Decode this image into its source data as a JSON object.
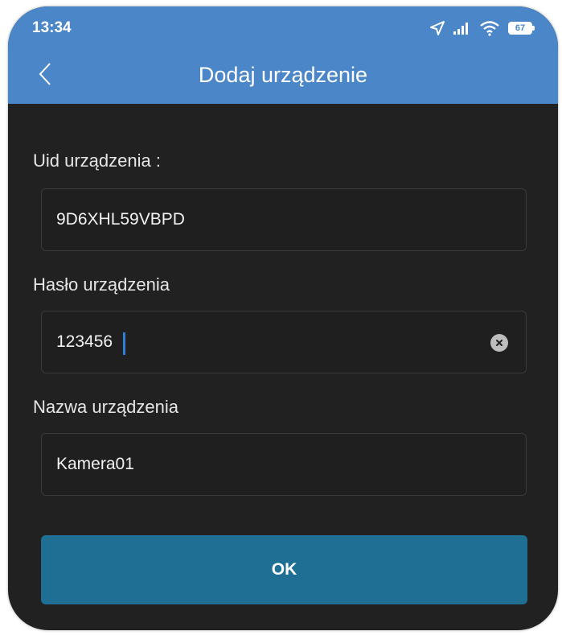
{
  "status_bar": {
    "time": "13:34",
    "battery": "67"
  },
  "header": {
    "title": "Dodaj urządzenie",
    "back_icon": "chevron-left-icon"
  },
  "form": {
    "uid": {
      "label": "Uid urządzenia :",
      "value": "9D6XHL59VBPD"
    },
    "password": {
      "label": "Hasło urządzenia",
      "value": "123456",
      "clear_icon": "clear-circle-icon"
    },
    "name": {
      "label": "Nazwa urządzenia",
      "value": "Kamera01"
    },
    "ok_label": "OK"
  },
  "colors": {
    "header_bg": "#4a86c8",
    "screen_bg": "#212121",
    "button_bg": "#1f6f95",
    "cursor": "#2f7fd8"
  }
}
